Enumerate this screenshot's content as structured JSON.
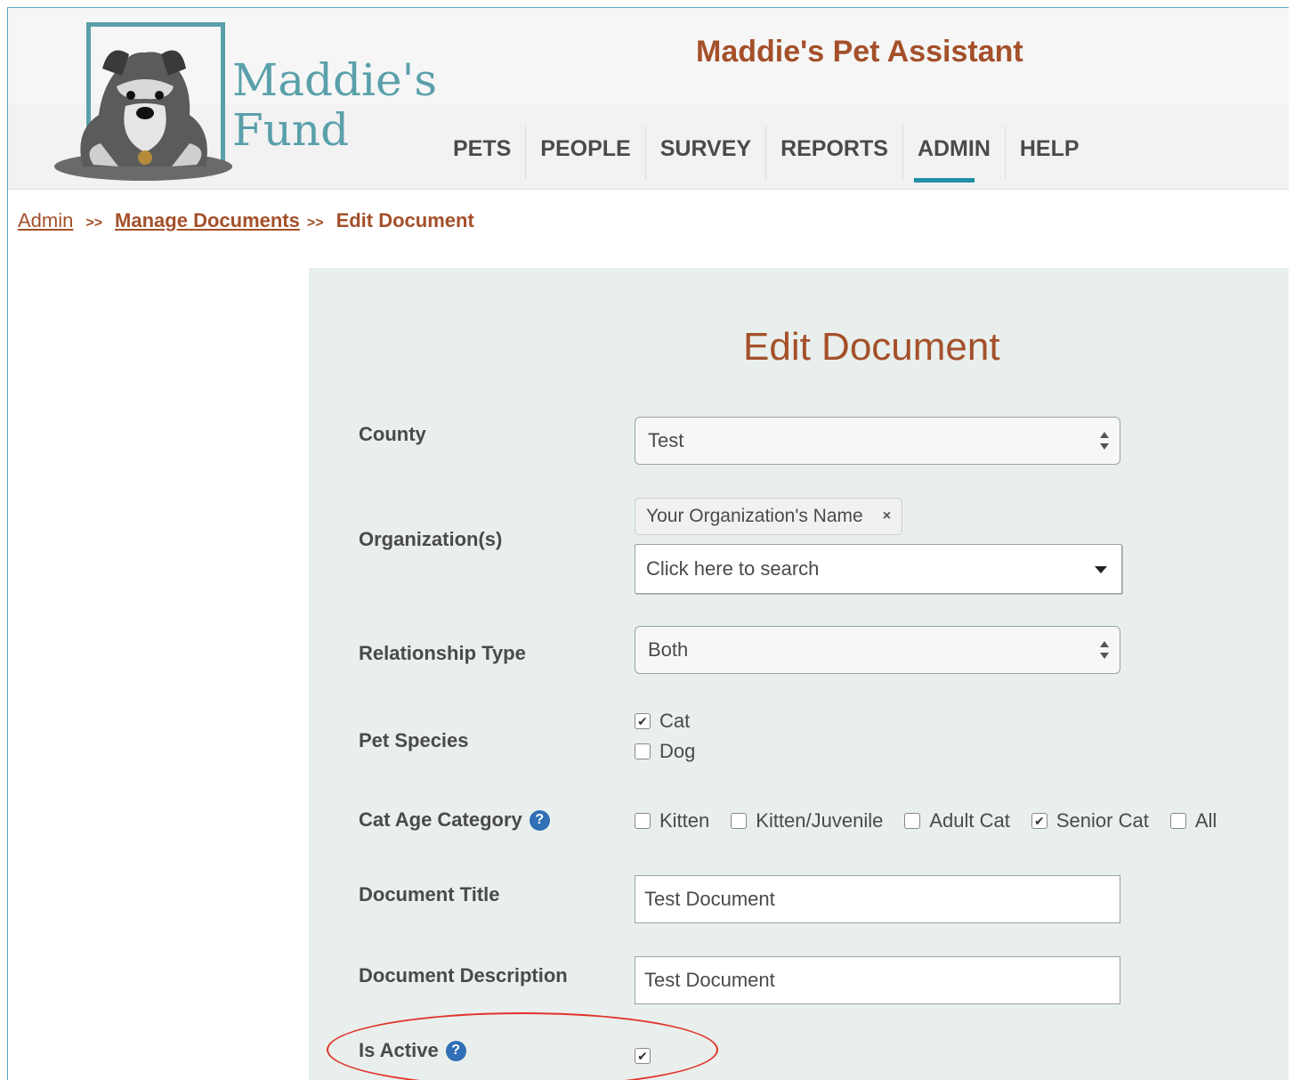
{
  "app": {
    "brand_line1": "Maddie's",
    "brand_line2": "Fund",
    "title": "Maddie's Pet Assistant"
  },
  "nav": {
    "items": [
      {
        "label": "PETS"
      },
      {
        "label": "PEOPLE"
      },
      {
        "label": "SURVEY"
      },
      {
        "label": "REPORTS"
      },
      {
        "label": "ADMIN",
        "active": true
      },
      {
        "label": "HELP"
      }
    ]
  },
  "breadcrumb": {
    "admin": "Admin",
    "sep": ">>",
    "manage": "Manage Documents",
    "current": "Edit Document"
  },
  "form": {
    "title": "Edit Document",
    "county": {
      "label": "County",
      "value": "Test"
    },
    "organizations": {
      "label": "Organization(s)",
      "selected_tag": "Your Organization's Name",
      "remove_icon": "×",
      "search_placeholder": "Click here to search"
    },
    "relationship_type": {
      "label": "Relationship Type",
      "value": "Both"
    },
    "pet_species": {
      "label": "Pet Species",
      "options": [
        {
          "label": "Cat",
          "checked": true
        },
        {
          "label": "Dog",
          "checked": false
        }
      ]
    },
    "cat_age_category": {
      "label": "Cat Age Category",
      "help": "?",
      "options": [
        {
          "label": "Kitten",
          "checked": false
        },
        {
          "label": "Kitten/Juvenile",
          "checked": false
        },
        {
          "label": "Adult Cat",
          "checked": false
        },
        {
          "label": "Senior Cat",
          "checked": true
        },
        {
          "label": "All",
          "checked": false
        }
      ]
    },
    "document_title": {
      "label": "Document Title",
      "value": "Test Document"
    },
    "document_description": {
      "label": "Document Description",
      "value": "Test Document"
    },
    "is_active": {
      "label": "Is Active",
      "help": "?",
      "checked": true
    }
  },
  "colors": {
    "brand_teal": "#5aa0aa",
    "title_rust": "#a4502a",
    "nav_active_underline": "#1f8fa6",
    "panel_bg": "#e9efec",
    "help_blue": "#2f6fb5",
    "annotation_red": "#e0332a"
  }
}
